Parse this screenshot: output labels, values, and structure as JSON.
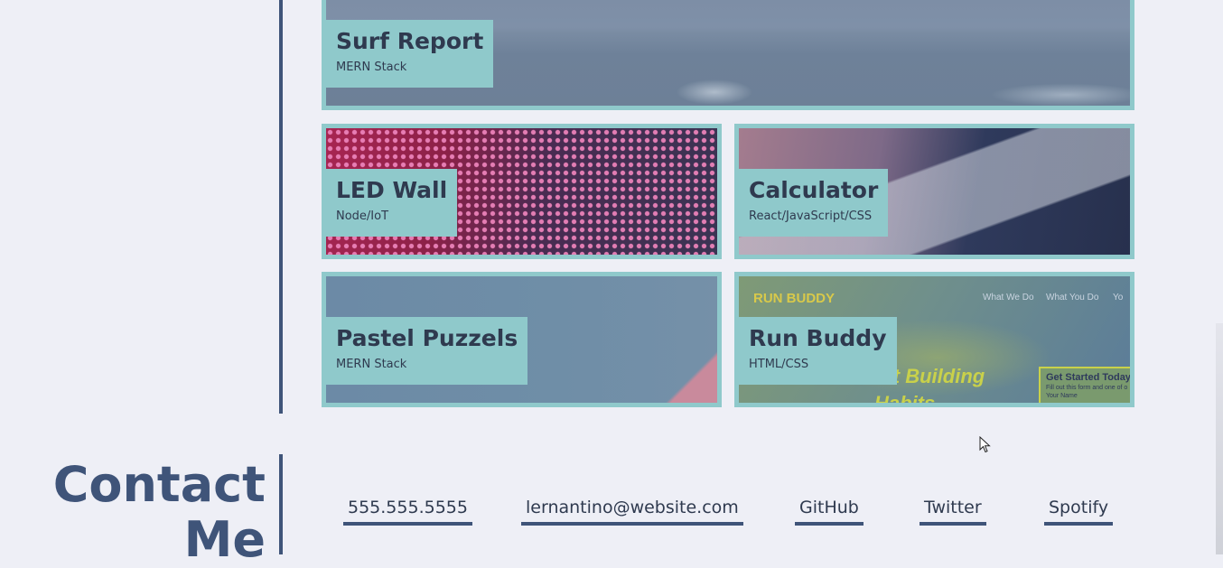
{
  "projects": [
    {
      "name": "Surf Report",
      "tech": "MERN Stack"
    },
    {
      "name": "LED Wall",
      "tech": "Node/IoT"
    },
    {
      "name": "Calculator",
      "tech": "React/JavaScript/CSS"
    },
    {
      "name": "Pastel Puzzels",
      "tech": "MERN Stack"
    },
    {
      "name": "Run Buddy",
      "tech": "HTML/CSS"
    }
  ],
  "run_buddy_screenshot": {
    "logo": "RUN BUDDY",
    "nav": [
      "What We Do",
      "What You Do",
      "Yo"
    ],
    "hero": "art Building Habits",
    "form_title": "Get Started Today",
    "form_sub": "Fill out this form and one of o",
    "form_field": "Your Name"
  },
  "contact": {
    "title_line1": "Contact",
    "title_line2": "Me",
    "phone": "555.555.5555",
    "email": "lernantino@website.com",
    "github": "GitHub",
    "twitter": "Twitter",
    "spotify": "Spotify"
  },
  "colors": {
    "accent": "#8fc9cb",
    "heading": "#3f5479",
    "background": "#eeeff6"
  }
}
